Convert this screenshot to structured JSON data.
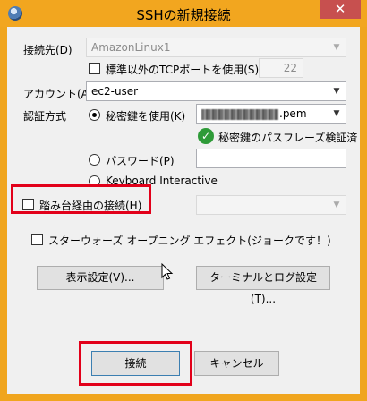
{
  "window": {
    "title": "SSHの新規接続",
    "close_glyph": "✕"
  },
  "form": {
    "host_label": "接続先(D)",
    "host_value": "AmazonLinux1",
    "nonstandard_port_label": "標準以外のTCPポートを使用(S)",
    "port_value": "22",
    "account_label": "アカウント(A)",
    "account_value": "ec2-user",
    "auth_label": "認証方式",
    "auth_key_label": "秘密鍵を使用(K)",
    "key_file_suffix": ".pem",
    "passphrase_status": "秘密鍵のパスフレーズ検証済",
    "auth_password_label": "パスワード(P)",
    "auth_keyboard_label": "Keyboard Interactive",
    "bastion_label": "踏み台経由の接続(H)",
    "starwars_label": "スターウォーズ オープニング エフェクト(ジョークです！)"
  },
  "buttons": {
    "display_settings": "表示設定(V)...",
    "terminal_log_settings": "ターミナルとログ設定(T)...",
    "connect": "接続",
    "cancel": "キャンセル"
  },
  "state": {
    "nonstandard_port_checked": false,
    "auth_method_selected": "key",
    "bastion_checked": false,
    "starwars_checked": false
  },
  "colors": {
    "title_bar": "#f2a61f",
    "close_button": "#c7504f",
    "highlight_box": "#e2001a",
    "verified_icon": "#2e9b38"
  }
}
